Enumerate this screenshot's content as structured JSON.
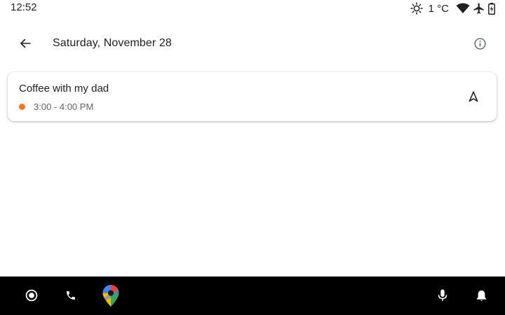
{
  "status_bar": {
    "time": "12:52",
    "temperature": "1 °C",
    "icons": [
      "brightness-icon",
      "wifi-icon",
      "airplane-icon",
      "battery-icon"
    ]
  },
  "header": {
    "back_icon": "arrow-back-icon",
    "title": "Saturday, November 28",
    "info_icon": "info-icon"
  },
  "events": [
    {
      "title": "Coffee with my dad",
      "time": "3:00 - 4:00 PM",
      "color": "#f4772c",
      "action_icon": "navigation-arrow-icon"
    }
  ],
  "bottom_bar": {
    "left": [
      "home-circle-icon",
      "phone-icon",
      "google-maps-icon"
    ],
    "right": [
      "microphone-icon",
      "notification-bell-icon"
    ]
  },
  "colors": {
    "background": "#ffffff",
    "text_primary": "#202124",
    "text_secondary": "#5f6368",
    "nav_bar": "#000000",
    "event_accent": "#f4772c"
  }
}
